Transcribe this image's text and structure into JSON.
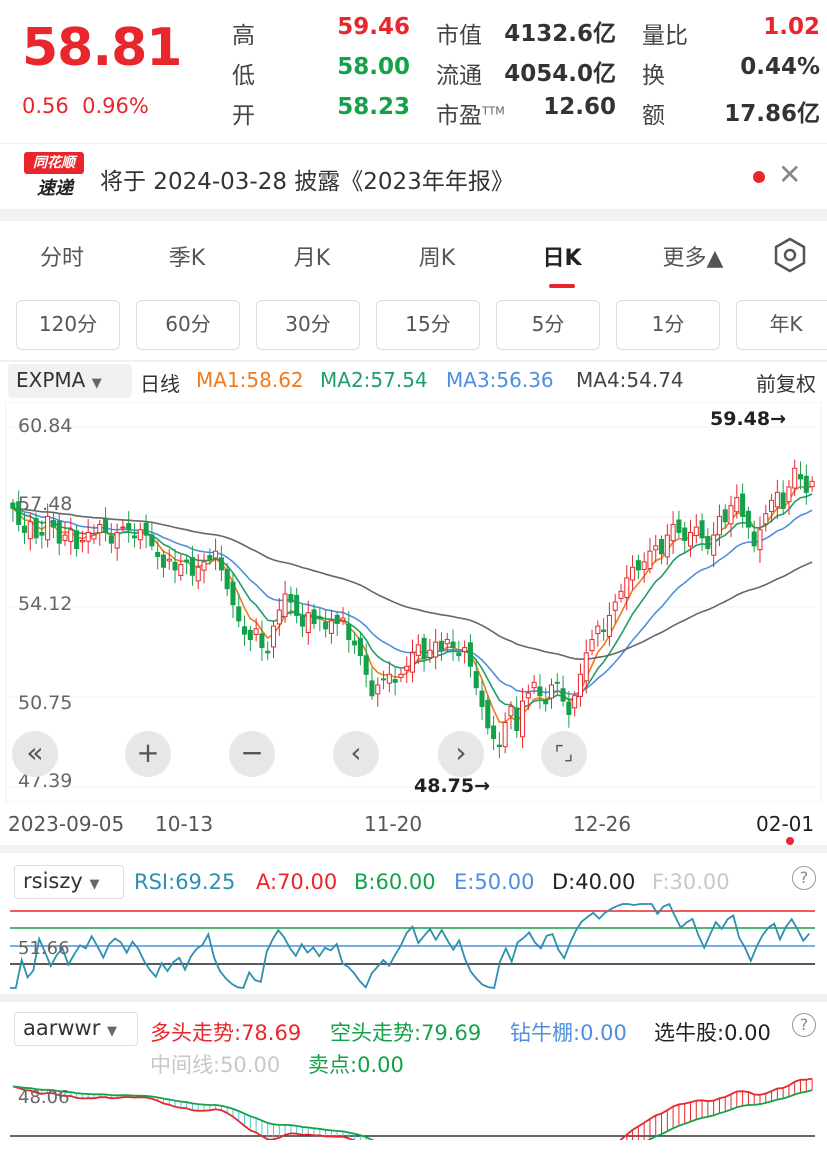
{
  "quote": {
    "price": "58.81",
    "change": "0.56",
    "change_pct": "0.96%",
    "high_label": "高",
    "high": "59.46",
    "low_label": "低",
    "low": "58.00",
    "open_label": "开",
    "open": "58.23",
    "mcap_label": "市值",
    "mcap": "4132.6亿",
    "float_label": "流通",
    "float": "4054.0亿",
    "pe_label": "市盈",
    "pe_sup": "TTM",
    "pe": "12.60",
    "vr_label": "量比",
    "vr": "1.02",
    "turn_label": "换",
    "turn": "0.44%",
    "amount_label": "额",
    "amount": "17.86亿",
    "colors": {
      "up": "#e8262c",
      "down": "#15a04a"
    }
  },
  "news": {
    "logo_line1": "同花顺",
    "logo_line2": "速递",
    "text": "将于 2024-03-28 披露《2023年年报》",
    "close_icon": "close-icon"
  },
  "tabs": [
    {
      "label": "分时"
    },
    {
      "label": "季K"
    },
    {
      "label": "月K"
    },
    {
      "label": "周K"
    },
    {
      "label": "日K"
    },
    {
      "label": "更多▲"
    }
  ],
  "chips": [
    "120分",
    "60分",
    "30分",
    "15分",
    "5分",
    "1分",
    "年K"
  ],
  "indicator_bar": {
    "selector": "EXPMA",
    "period": "日线",
    "ma1": "MA1:58.62",
    "ma2": "MA2:57.54",
    "ma3": "MA3:56.36",
    "ma4": "MA4:54.74",
    "adjust": "前复权",
    "colors": {
      "ma1": "#f07a1c",
      "ma2": "#1f9e6a",
      "ma3": "#4f8ee0",
      "ma4": "#666666"
    }
  },
  "chart_data": {
    "type": "candlestick",
    "y_ticks": [
      "60.84",
      "57.48",
      "54.12",
      "50.75",
      "47.39"
    ],
    "ylim": [
      47.39,
      60.84
    ],
    "x_ticks": [
      "2023-09-05",
      "10-13",
      "11-20",
      "12-26",
      "02-01"
    ],
    "max_label": "59.48→",
    "min_label": "48.75→",
    "closes": [
      57.8,
      57.2,
      56.9,
      57.3,
      56.7,
      56.8,
      57.5,
      57.1,
      56.5,
      56.8,
      57.0,
      56.3,
      56.6,
      56.9,
      56.8,
      57.2,
      56.9,
      56.5,
      56.9,
      57.1,
      57.0,
      56.7,
      57.0,
      56.8,
      56.4,
      56.0,
      55.6,
      55.9,
      55.5,
      55.7,
      55.8,
      55.3,
      55.6,
      55.8,
      55.9,
      56.2,
      55.5,
      54.8,
      54.2,
      53.6,
      53.1,
      52.9,
      53.3,
      52.6,
      52.4,
      53.4,
      54.0,
      54.6,
      54.3,
      53.8,
      53.4,
      53.9,
      53.5,
      53.7,
      53.3,
      53.6,
      53.5,
      53.7,
      52.9,
      52.7,
      52.3,
      51.6,
      50.8,
      51.2,
      51.4,
      51.6,
      51.3,
      51.6,
      51.9,
      52.4,
      52.7,
      52.2,
      52.5,
      52.8,
      52.5,
      52.9,
      52.6,
      52.3,
      52.6,
      51.9,
      51.1,
      50.4,
      49.6,
      49.2,
      48.9,
      49.8,
      50.4,
      49.5,
      50.6,
      50.9,
      51.3,
      50.8,
      50.5,
      51.2,
      51.3,
      50.6,
      50.1,
      50.8,
      51.6,
      52.4,
      52.9,
      53.4,
      53.2,
      53.8,
      54.3,
      54.7,
      55.2,
      55.6,
      55.5,
      55.8,
      56.2,
      56.4,
      56.1,
      56.8,
      57.2,
      56.9,
      56.6,
      56.9,
      57.1,
      56.7,
      56.3,
      56.8,
      57.5,
      57.3,
      57.9,
      58.2,
      57.5,
      57.1,
      56.4,
      57.0,
      57.6,
      58.1,
      58.4,
      57.8,
      58.6,
      59.3,
      58.9,
      58.4,
      58.81
    ],
    "series": [
      {
        "name": "MA1",
        "color": "#f07a1c"
      },
      {
        "name": "MA2",
        "color": "#1f9e6a"
      },
      {
        "name": "MA3",
        "color": "#4f8ee0"
      },
      {
        "name": "MA4",
        "color": "#666666"
      }
    ]
  },
  "rsi_panel": {
    "selector": "rsiszy",
    "rsi": "RSI:69.25",
    "a": "A:70.00",
    "b": "B:60.00",
    "e": "E:50.00",
    "d": "D:40.00",
    "f": "F:30.00",
    "y_label": "51.66",
    "help_icon": "?"
  },
  "trend_panel": {
    "selector": "aarwwr",
    "bull": "多头走势:78.69",
    "bear": "空头走势:79.69",
    "bottom": "钻牛棚:0.00",
    "pick": "选牛股:0.00",
    "mid": "中间线:50.00",
    "sell": "卖点:0.00",
    "y_label": "48.06",
    "help_icon": "?"
  }
}
